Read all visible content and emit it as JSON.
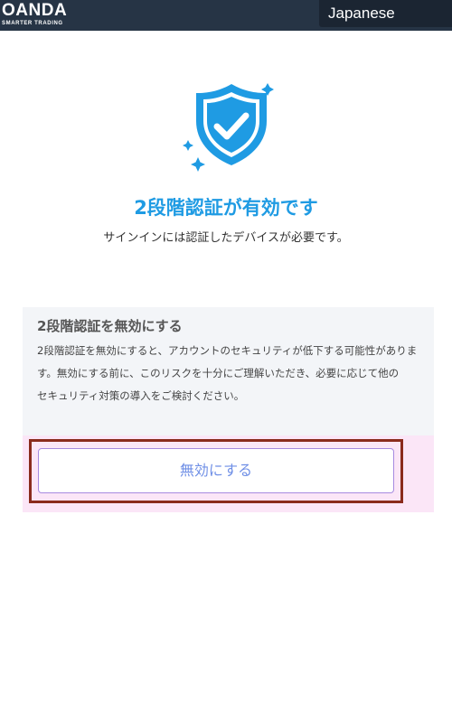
{
  "header": {
    "logo_text": "OANDA",
    "logo_tagline": "SMARTER TRADING",
    "language": "Japanese"
  },
  "main": {
    "icon": "shield-check-icon",
    "title": "2段階認証が有効です",
    "subtitle": "サインインには認証したデバイスが必要です。"
  },
  "disable_section": {
    "title": "2段階認証を無効にする",
    "description_lines": [
      "2段階認証を無効にすると、アカウントのセキュリティが低下する可能性がありま",
      "す。無効にする前に、このリスクを十分にご理解いただき、必要に応じて他の",
      "セキュリティ対策の導入をご検討ください。"
    ],
    "button_label": "無効にする"
  },
  "colors": {
    "header_bg": "#263445",
    "accent_blue": "#1f9be3",
    "card_bg": "#f3f5f8",
    "button_border": "#a78ae0",
    "button_text": "#6f8fe6",
    "highlight_bg": "#fbe6f7",
    "highlight_frame": "#8a2b1c"
  }
}
